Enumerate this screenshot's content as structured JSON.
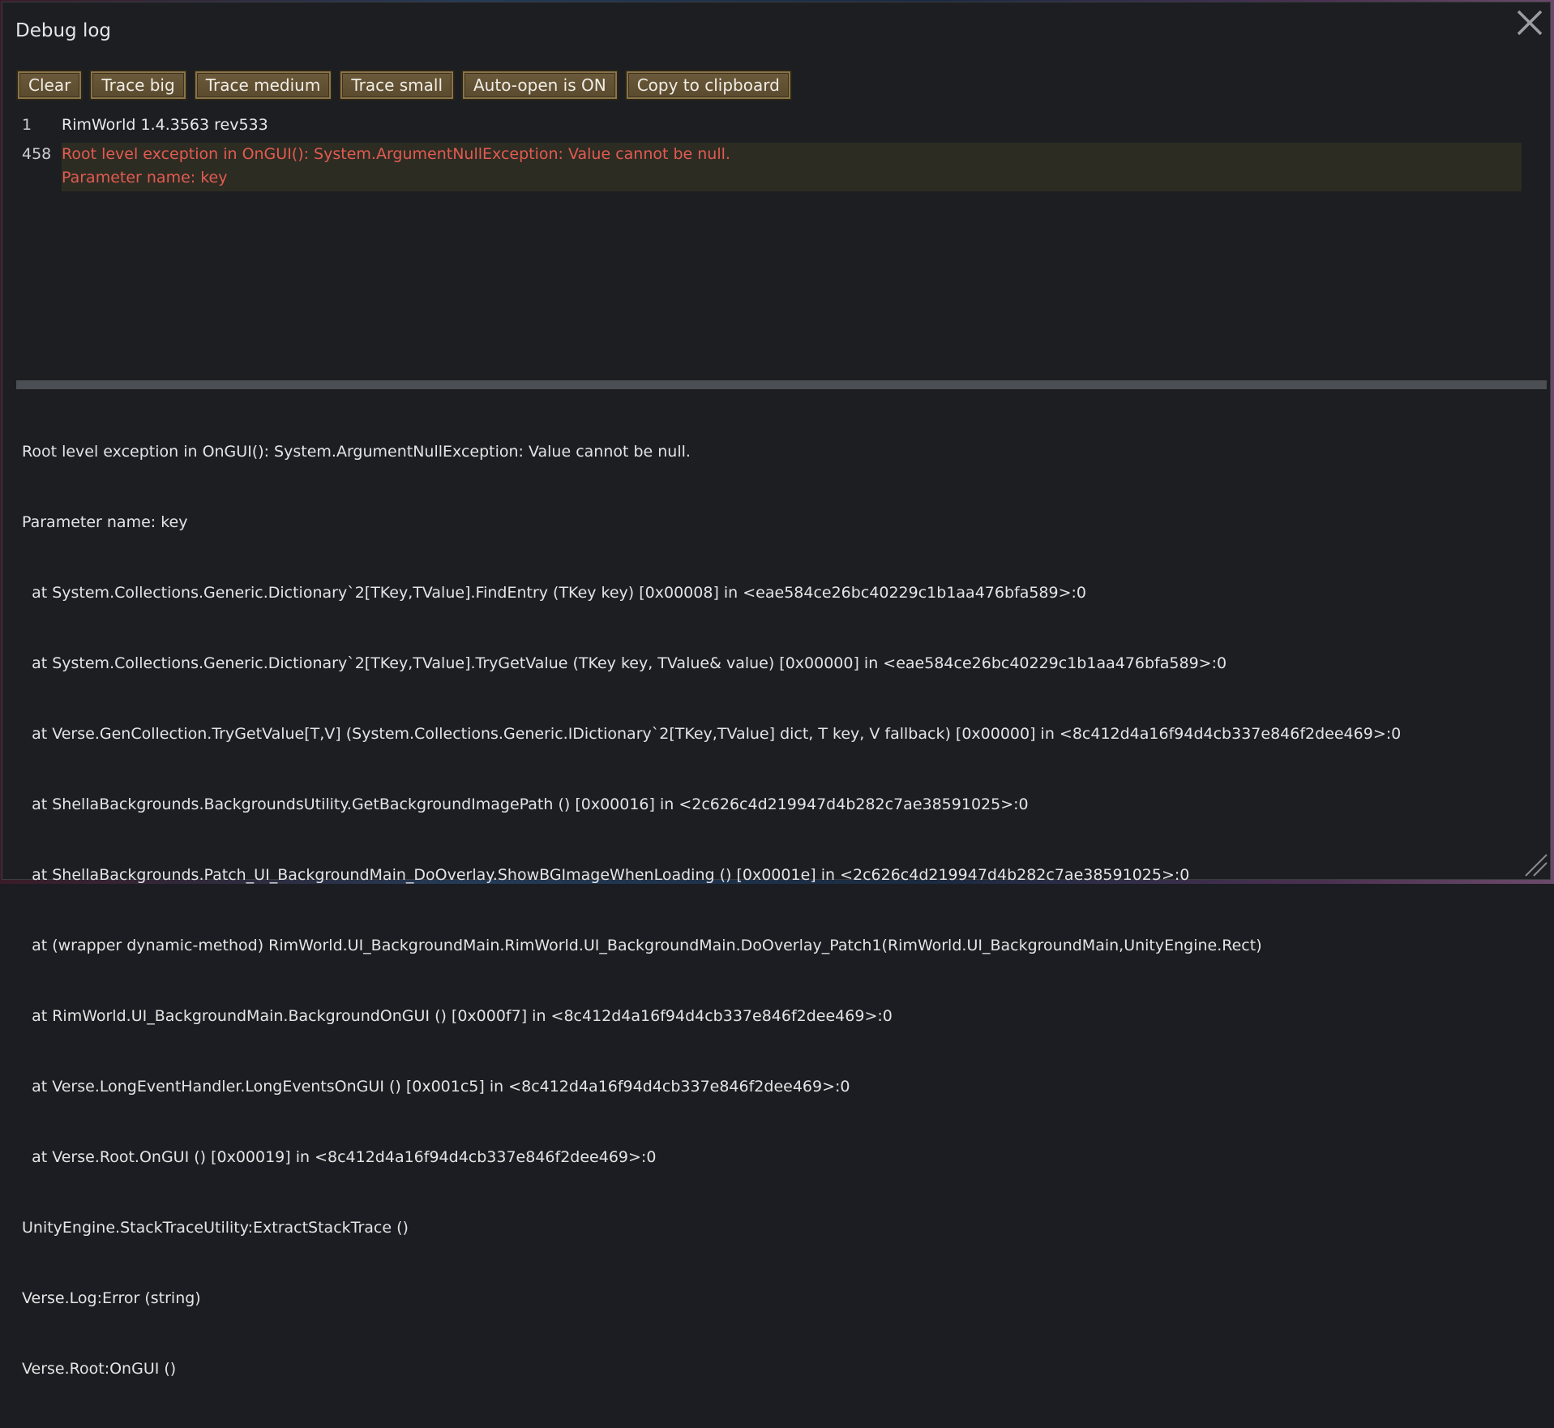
{
  "window": {
    "title": "Debug log"
  },
  "toolbar": {
    "buttons": [
      {
        "label": "Clear"
      },
      {
        "label": "Trace big"
      },
      {
        "label": "Trace medium"
      },
      {
        "label": "Trace small"
      },
      {
        "label": "Auto-open is ON"
      },
      {
        "label": "Copy to clipboard"
      }
    ]
  },
  "log": {
    "entries": [
      {
        "count": "1",
        "text": "RimWorld 1.4.3563 rev533",
        "type": "info"
      },
      {
        "count": "458",
        "text": "Root level exception in OnGUI(): System.ArgumentNullException: Value cannot be null.\nParameter name: key",
        "type": "error"
      }
    ]
  },
  "detail": {
    "lines": [
      "Root level exception in OnGUI(): System.ArgumentNullException: Value cannot be null.",
      "Parameter name: key",
      "  at System.Collections.Generic.Dictionary`2[TKey,TValue].FindEntry (TKey key) [0x00008] in <eae584ce26bc40229c1b1aa476bfa589>:0",
      "  at System.Collections.Generic.Dictionary`2[TKey,TValue].TryGetValue (TKey key, TValue& value) [0x00000] in <eae584ce26bc40229c1b1aa476bfa589>:0",
      "  at Verse.GenCollection.TryGetValue[T,V] (System.Collections.Generic.IDictionary`2[TKey,TValue] dict, T key, V fallback) [0x00000] in <8c412d4a16f94d4cb337e846f2dee469>:0",
      "  at ShellaBackgrounds.BackgroundsUtility.GetBackgroundImagePath () [0x00016] in <2c626c4d219947d4b282c7ae38591025>:0",
      "  at ShellaBackgrounds.Patch_UI_BackgroundMain_DoOverlay.ShowBGImageWhenLoading () [0x0001e] in <2c626c4d219947d4b282c7ae38591025>:0",
      "  at (wrapper dynamic-method) RimWorld.UI_BackgroundMain.RimWorld.UI_BackgroundMain.DoOverlay_Patch1(RimWorld.UI_BackgroundMain,UnityEngine.Rect)",
      "  at RimWorld.UI_BackgroundMain.BackgroundOnGUI () [0x000f7] in <8c412d4a16f94d4cb337e846f2dee469>:0",
      "  at Verse.LongEventHandler.LongEventsOnGUI () [0x001c5] in <8c412d4a16f94d4cb337e846f2dee469>:0",
      "  at Verse.Root.OnGUI () [0x00019] in <8c412d4a16f94d4cb337e846f2dee469>:0",
      "UnityEngine.StackTraceUtility:ExtractStackTrace ()",
      "Verse.Log:Error (string)",
      "Verse.Root:OnGUI ()"
    ]
  },
  "colors": {
    "error_text": "#e25b52",
    "error_row_bg": "#2d2c22",
    "button_bg": "#6b5a3a",
    "window_bg": "#1c1e22"
  },
  "icons": {
    "close": "close-icon",
    "resize": "resize-grip-icon"
  }
}
